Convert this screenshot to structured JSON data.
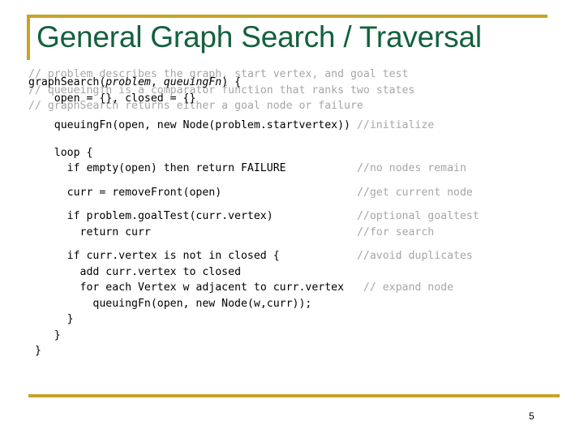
{
  "slide": {
    "title": "General Graph Search / Traversal",
    "page_number": "5",
    "accent_color": "#c9a227",
    "title_color": "#14613d",
    "comment_color": "#a6a6a6",
    "code_color": "#000000",
    "background_color": "#ffffff"
  },
  "header_comments": [
    "// problem describes the graph, start vertex, and goal test",
    "// queueingfn is a comparator function that ranks two states",
    "// graphSearch returns either a goal node or failure"
  ],
  "code": {
    "signature": {
      "prefix": "graphSearch(",
      "param1": "problem",
      "separator": ", ",
      "param2": "queuingFn",
      "suffix": ") {"
    },
    "lines": [
      {
        "indent": 4,
        "text": "open = {}, closed = {}",
        "comment": "",
        "comment_col": 0
      },
      {
        "indent": 4,
        "text": "queuingFn(open, new Node(problem.startvertex))",
        "comment": "//initialize",
        "comment_col": 51
      },
      {
        "indent": 4,
        "text": "loop {",
        "comment": "",
        "comment_col": 0
      },
      {
        "indent": 6,
        "text": "if empty(open) then return FAILURE",
        "comment": "//no nodes remain",
        "comment_col": 51
      },
      {
        "indent": 6,
        "text": "curr = removeFront(open)",
        "comment": "//get current node",
        "comment_col": 51
      },
      {
        "indent": 6,
        "text": "if problem.goalTest(curr.vertex)",
        "comment": "//optional goaltest",
        "comment_col": 51
      },
      {
        "indent": 8,
        "text": "return curr",
        "comment": "//for search",
        "comment_col": 51
      },
      {
        "indent": 6,
        "text": "if curr.vertex is not in closed {",
        "comment": "//avoid duplicates",
        "comment_col": 51
      },
      {
        "indent": 8,
        "text": "add curr.vertex to closed",
        "comment": "",
        "comment_col": 0
      },
      {
        "indent": 8,
        "text": "for each Vertex w adjacent to curr.vertex",
        "comment": "// expand node",
        "comment_col": 52
      },
      {
        "indent": 10,
        "text": "queuingFn(open, new Node(w,curr));",
        "comment": "",
        "comment_col": 0
      },
      {
        "indent": 6,
        "text": "}",
        "comment": "",
        "comment_col": 0
      },
      {
        "indent": 4,
        "text": "}",
        "comment": "",
        "comment_col": 0
      },
      {
        "indent": 1,
        "text": "}",
        "comment": "",
        "comment_col": 0
      }
    ]
  }
}
